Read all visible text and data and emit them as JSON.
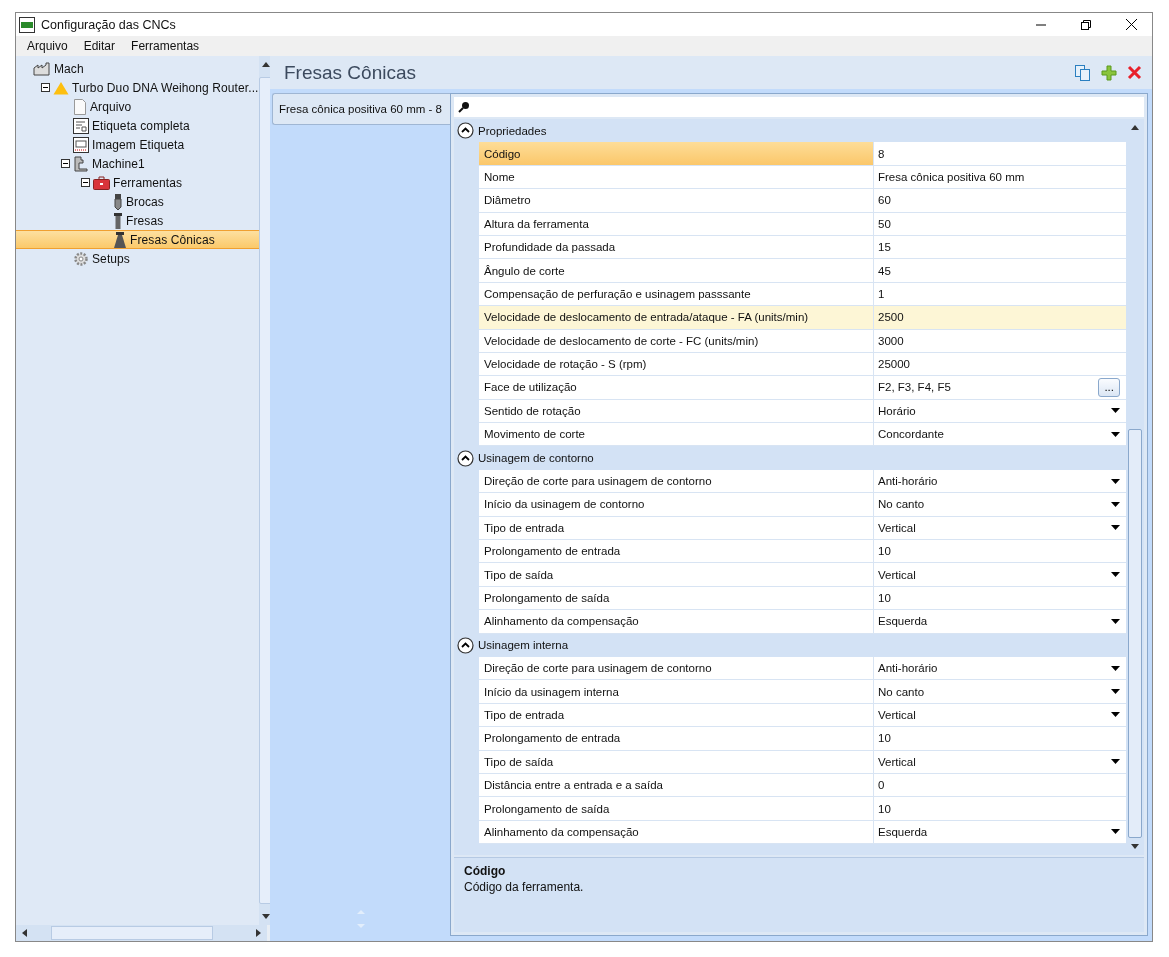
{
  "window": {
    "title": "Configuração das CNCs"
  },
  "menu": [
    "Arquivo",
    "Editar",
    "Ferramentas"
  ],
  "tree": [
    {
      "label": "Mach",
      "kind": "factory",
      "selected": false,
      "expanded": true,
      "children": [
        {
          "label": "Turbo Duo DNA Weihong Router...",
          "kind": "warning",
          "selected": false,
          "expanded": true,
          "children": [
            {
              "label": "Arquivo",
              "kind": "document",
              "selected": false
            },
            {
              "label": "Etiqueta completa",
              "kind": "label",
              "selected": false
            },
            {
              "label": "Imagem Etiqueta",
              "kind": "image-label",
              "selected": false
            },
            {
              "label": "Machine1",
              "kind": "machine",
              "selected": false,
              "expanded": true,
              "children": [
                {
                  "label": "Ferramentas",
                  "kind": "toolbox",
                  "selected": false,
                  "expanded": true,
                  "children": [
                    {
                      "label": "Brocas",
                      "kind": "drill",
                      "selected": false
                    },
                    {
                      "label": "Fresas",
                      "kind": "mill",
                      "selected": false
                    },
                    {
                      "label": "Fresas Cônicas",
                      "kind": "cone",
                      "selected": true
                    }
                  ]
                }
              ]
            },
            {
              "label": "Setups",
              "kind": "gear",
              "selected": false
            }
          ]
        }
      ]
    }
  ],
  "panel": {
    "title": "Fresas Cônicas"
  },
  "items": [
    {
      "label": "Fresa cônica positiva 60 mm - 8",
      "selected": true
    }
  ],
  "grid": {
    "categories": [
      {
        "label": "Propriedades",
        "expanded": true,
        "rows": [
          {
            "name": "Código",
            "value": "8",
            "kind": "text",
            "selected": true,
            "highlighted": false
          },
          {
            "name": "Nome",
            "value": "Fresa cônica positiva 60 mm",
            "kind": "text",
            "selected": false,
            "highlighted": false
          },
          {
            "name": "Diâmetro",
            "value": "60",
            "kind": "text",
            "selected": false,
            "highlighted": false
          },
          {
            "name": "Altura da ferramenta",
            "value": "50",
            "kind": "text",
            "selected": false,
            "highlighted": false
          },
          {
            "name": "Profundidade da passada",
            "value": "15",
            "kind": "text",
            "selected": false,
            "highlighted": false
          },
          {
            "name": "Ângulo de corte",
            "value": "45",
            "kind": "text",
            "selected": false,
            "highlighted": false
          },
          {
            "name": "Compensação de perfuração e usinagem passsante",
            "value": "1",
            "kind": "text",
            "selected": false,
            "highlighted": false
          },
          {
            "name": "Velocidade de deslocamento de entrada/ataque - FA (units/min)",
            "value": "2500",
            "kind": "text",
            "selected": false,
            "highlighted": true
          },
          {
            "name": "Velocidade de deslocamento de corte - FC (units/min)",
            "value": "3000",
            "kind": "text",
            "selected": false,
            "highlighted": false
          },
          {
            "name": "Velocidade de rotação - S (rpm)",
            "value": "25000",
            "kind": "text",
            "selected": false,
            "highlighted": false
          },
          {
            "name": "Face de utilização",
            "value": "F2, F3, F4, F5",
            "kind": "ellipsis",
            "button": "...",
            "selected": false,
            "highlighted": false
          },
          {
            "name": "Sentido de rotação",
            "value": "Horário",
            "kind": "dropdown",
            "selected": false,
            "highlighted": false
          },
          {
            "name": "Movimento de corte",
            "value": "Concordante",
            "kind": "dropdown",
            "selected": false,
            "highlighted": false
          }
        ]
      },
      {
        "label": "Usinagem de contorno",
        "expanded": true,
        "rows": [
          {
            "name": "Direção de corte para usinagem de contorno",
            "value": "Anti-horário",
            "kind": "dropdown",
            "selected": false,
            "highlighted": false
          },
          {
            "name": "Início da usinagem de contorno",
            "value": "No canto",
            "kind": "dropdown",
            "selected": false,
            "highlighted": false
          },
          {
            "name": "Tipo de entrada",
            "value": "Vertical",
            "kind": "dropdown",
            "selected": false,
            "highlighted": false
          },
          {
            "name": "Prolongamento de entrada",
            "value": "10",
            "kind": "text",
            "selected": false,
            "highlighted": false
          },
          {
            "name": "Tipo de saída",
            "value": "Vertical",
            "kind": "dropdown",
            "selected": false,
            "highlighted": false
          },
          {
            "name": "Prolongamento de saída",
            "value": "10",
            "kind": "text",
            "selected": false,
            "highlighted": false
          },
          {
            "name": "Alinhamento da compensação",
            "value": "Esquerda",
            "kind": "dropdown",
            "selected": false,
            "highlighted": false
          }
        ]
      },
      {
        "label": "Usinagem interna",
        "expanded": true,
        "rows": [
          {
            "name": "Direção de corte para usinagem de contorno",
            "value": "Anti-horário",
            "kind": "dropdown",
            "selected": false,
            "highlighted": false
          },
          {
            "name": "Início da usinagem interna",
            "value": "No canto",
            "kind": "dropdown",
            "selected": false,
            "highlighted": false
          },
          {
            "name": "Tipo de entrada",
            "value": "Vertical",
            "kind": "dropdown",
            "selected": false,
            "highlighted": false
          },
          {
            "name": "Prolongamento de entrada",
            "value": "10",
            "kind": "text",
            "selected": false,
            "highlighted": false
          },
          {
            "name": "Tipo de saída",
            "value": "Vertical",
            "kind": "dropdown",
            "selected": false,
            "highlighted": false
          },
          {
            "name": "Distância entre a entrada e a saída",
            "value": "0",
            "kind": "text",
            "selected": false,
            "highlighted": false
          },
          {
            "name": "Prolongamento de saída",
            "value": "10",
            "kind": "text",
            "selected": false,
            "highlighted": false
          },
          {
            "name": "Alinhamento da compensação",
            "value": "Esquerda",
            "kind": "dropdown",
            "selected": false,
            "highlighted": false
          }
        ]
      }
    ]
  },
  "description": {
    "title": "Código",
    "text": "Código da ferramenta."
  }
}
